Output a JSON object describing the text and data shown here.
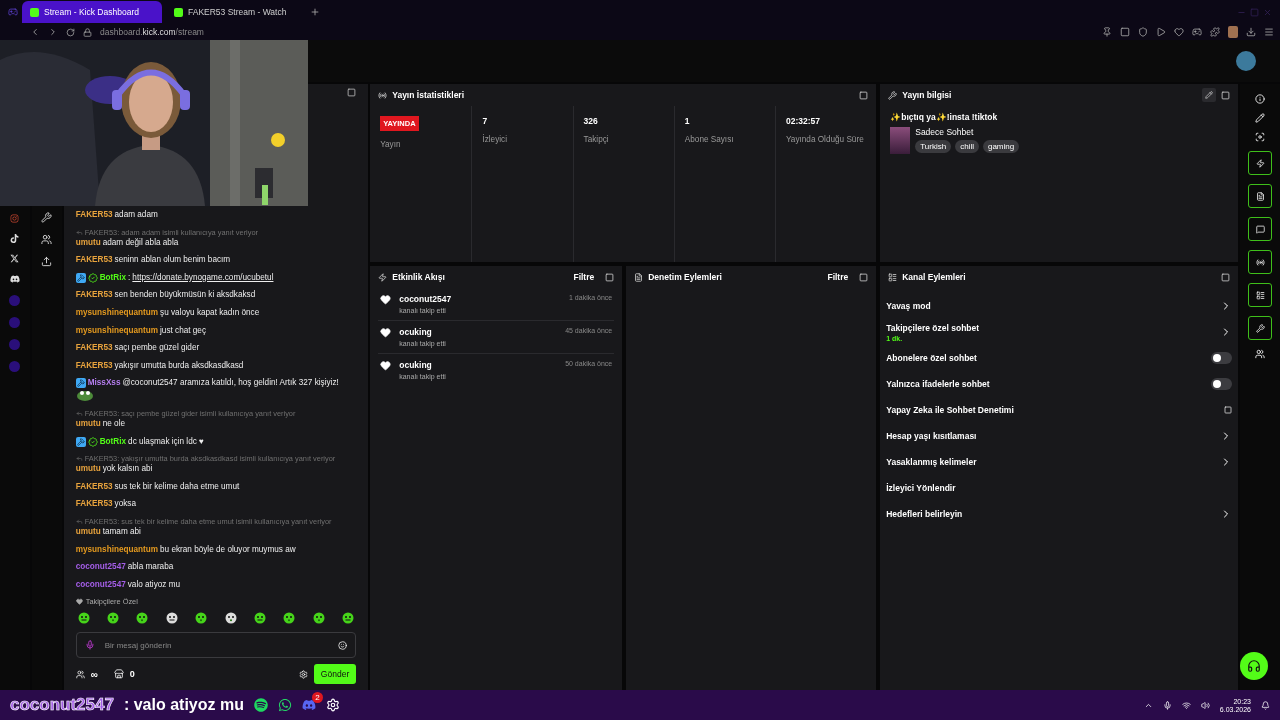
{
  "browser": {
    "tabs": [
      {
        "title": "Stream - Kick Dashboard",
        "selected": true
      },
      {
        "title": "FAKER53 Stream - Watch",
        "selected": false
      }
    ],
    "url_host": "dashboard.",
    "url_domain": "kick.com",
    "url_path": "/stream"
  },
  "chat": {
    "messages": [
      {
        "user": "FAKER53",
        "color": "#e8a33d",
        "text": "adam adam"
      },
      {
        "reply": "FAKER53: adam adam isimli kullanıcıya yanıt veriyor",
        "user": "umutu",
        "color": "#e8a33d",
        "text": "adam değil abla abla"
      },
      {
        "user": "FAKER53",
        "color": "#e8a33d",
        "text": "seninn ablan olum benim bacım"
      },
      {
        "user": "BotRix",
        "color": "#53fc18",
        "mod": true,
        "verified": true,
        "text": ":",
        "link": "https://donate.bynogame.com/ucubetul"
      },
      {
        "user": "FAKER53",
        "color": "#e8a33d",
        "text": "sen benden büyükmüsün ki aksdkaksd"
      },
      {
        "user": "mysunshinequantum",
        "color": "#e59a1f",
        "text": "şu valoyu kapat kadın önce"
      },
      {
        "user": "mysunshinequantum",
        "color": "#e59a1f",
        "text": "just chat geç"
      },
      {
        "user": "FAKER53",
        "color": "#e8a33d",
        "text": "saçı pembe güzel gider"
      },
      {
        "user": "FAKER53",
        "color": "#e8a33d",
        "text": "yakışır umutta burda aksdkasdkasd"
      },
      {
        "user": "MissXss",
        "color": "#b57ef0",
        "mod": true,
        "text": "@coconut2547 aramıza katıldı, hoş geldin! Artık 327 kişiyiz!",
        "emote": true
      },
      {
        "reply": "FAKER53: saçı pembe güzel gider isimli kullanıcıya yanıt veriyor",
        "user": "umutu",
        "color": "#e8a33d",
        "text": "ne ole"
      },
      {
        "user": "BotRix",
        "color": "#53fc18",
        "mod": true,
        "verified": true,
        "text": "dc ulaşmak için ldc ♥"
      },
      {
        "reply": "FAKER53: yakışır umutta burda aksdkasdkasd isimli kullanıcıya yanıt veriyor",
        "user": "umutu",
        "color": "#e8a33d",
        "text": "yok kalsın abi"
      },
      {
        "user": "FAKER53",
        "color": "#e8a33d",
        "text": "sus tek bir kelime daha etme umut"
      },
      {
        "user": "FAKER53",
        "color": "#e8a33d",
        "text": "yoksa"
      },
      {
        "reply": "FAKER53: sus tek bir kelime daha etme umut isimli kullanıcıya yanıt veriyor",
        "user": "umutu",
        "color": "#e8a33d",
        "text": "tamam abi"
      },
      {
        "user": "mysunshinequantum",
        "color": "#e59a1f",
        "text": "bu ekran böyle de oluyor muymus aw"
      },
      {
        "user": "coconut2547",
        "color": "#a45ee8",
        "text": "abla maraba"
      },
      {
        "user": "coconut2547",
        "color": "#a45ee8",
        "text": "valo atiyoz mu"
      }
    ],
    "emotes_label": "Takipçilere Özel",
    "placeholder": "Bir mesaj gönderin",
    "infinity": "∞",
    "points": "0",
    "send": "Gönder"
  },
  "stats": {
    "title": "Yayın İstatistikleri",
    "live_badge": "YAYINDA",
    "live_label": "Yayın",
    "items": [
      {
        "value": "7",
        "label": "İzleyici"
      },
      {
        "value": "326",
        "label": "Takipçi"
      },
      {
        "value": "1",
        "label": "Abone Sayısı"
      },
      {
        "value": "02:32:57",
        "label": "Yayında Olduğu Süre"
      }
    ]
  },
  "info": {
    "title": "Yayın bilgisi",
    "stream_title": "✨bıçtıq ya✨!insta !tiktok",
    "category": "Sadece Sohbet",
    "tags": [
      "Turkish",
      "chill",
      "gaming"
    ]
  },
  "activity": {
    "title": "Etkinlik Akışı",
    "filter": "Filtre",
    "events": [
      {
        "user": "coconut2547",
        "action": "kanalı takip etti",
        "time": "1 dakika önce"
      },
      {
        "user": "ocuking",
        "action": "kanalı takip etti",
        "time": "45 dakika önce"
      },
      {
        "user": "ocuking",
        "action": "kanalı takip etti",
        "time": "50 dakika önce"
      }
    ]
  },
  "moderation": {
    "title": "Denetim Eylemleri",
    "filter": "Filtre"
  },
  "channel_actions": {
    "title": "Kanal Eylemleri",
    "items": [
      {
        "kind": "link",
        "label": "Yavaş mod"
      },
      {
        "kind": "link",
        "label": "Takipçilere özel sohbet",
        "sub": "1 dk."
      },
      {
        "kind": "toggle",
        "label": "Abonelere özel sohbet",
        "on": false
      },
      {
        "kind": "toggle",
        "label": "Yalnızca ifadelerle sohbet",
        "on": false
      },
      {
        "kind": "external",
        "label": "Yapay Zeka ile Sohbet Denetimi"
      },
      {
        "kind": "link",
        "label": "Hesap yaşı kısıtlaması"
      },
      {
        "kind": "link",
        "label": "Yasaklanmış kelimeler"
      },
      {
        "kind": "plain",
        "label": "İzleyici Yönlendir"
      },
      {
        "kind": "link",
        "label": "Hedefleri belirleyin"
      }
    ]
  },
  "overlay": {
    "user": "coconut2547",
    "text": ": valo atiyoz mu"
  },
  "taskbar": {
    "discord_badge": "2",
    "time": "20:23",
    "date": "6.03.2026"
  }
}
